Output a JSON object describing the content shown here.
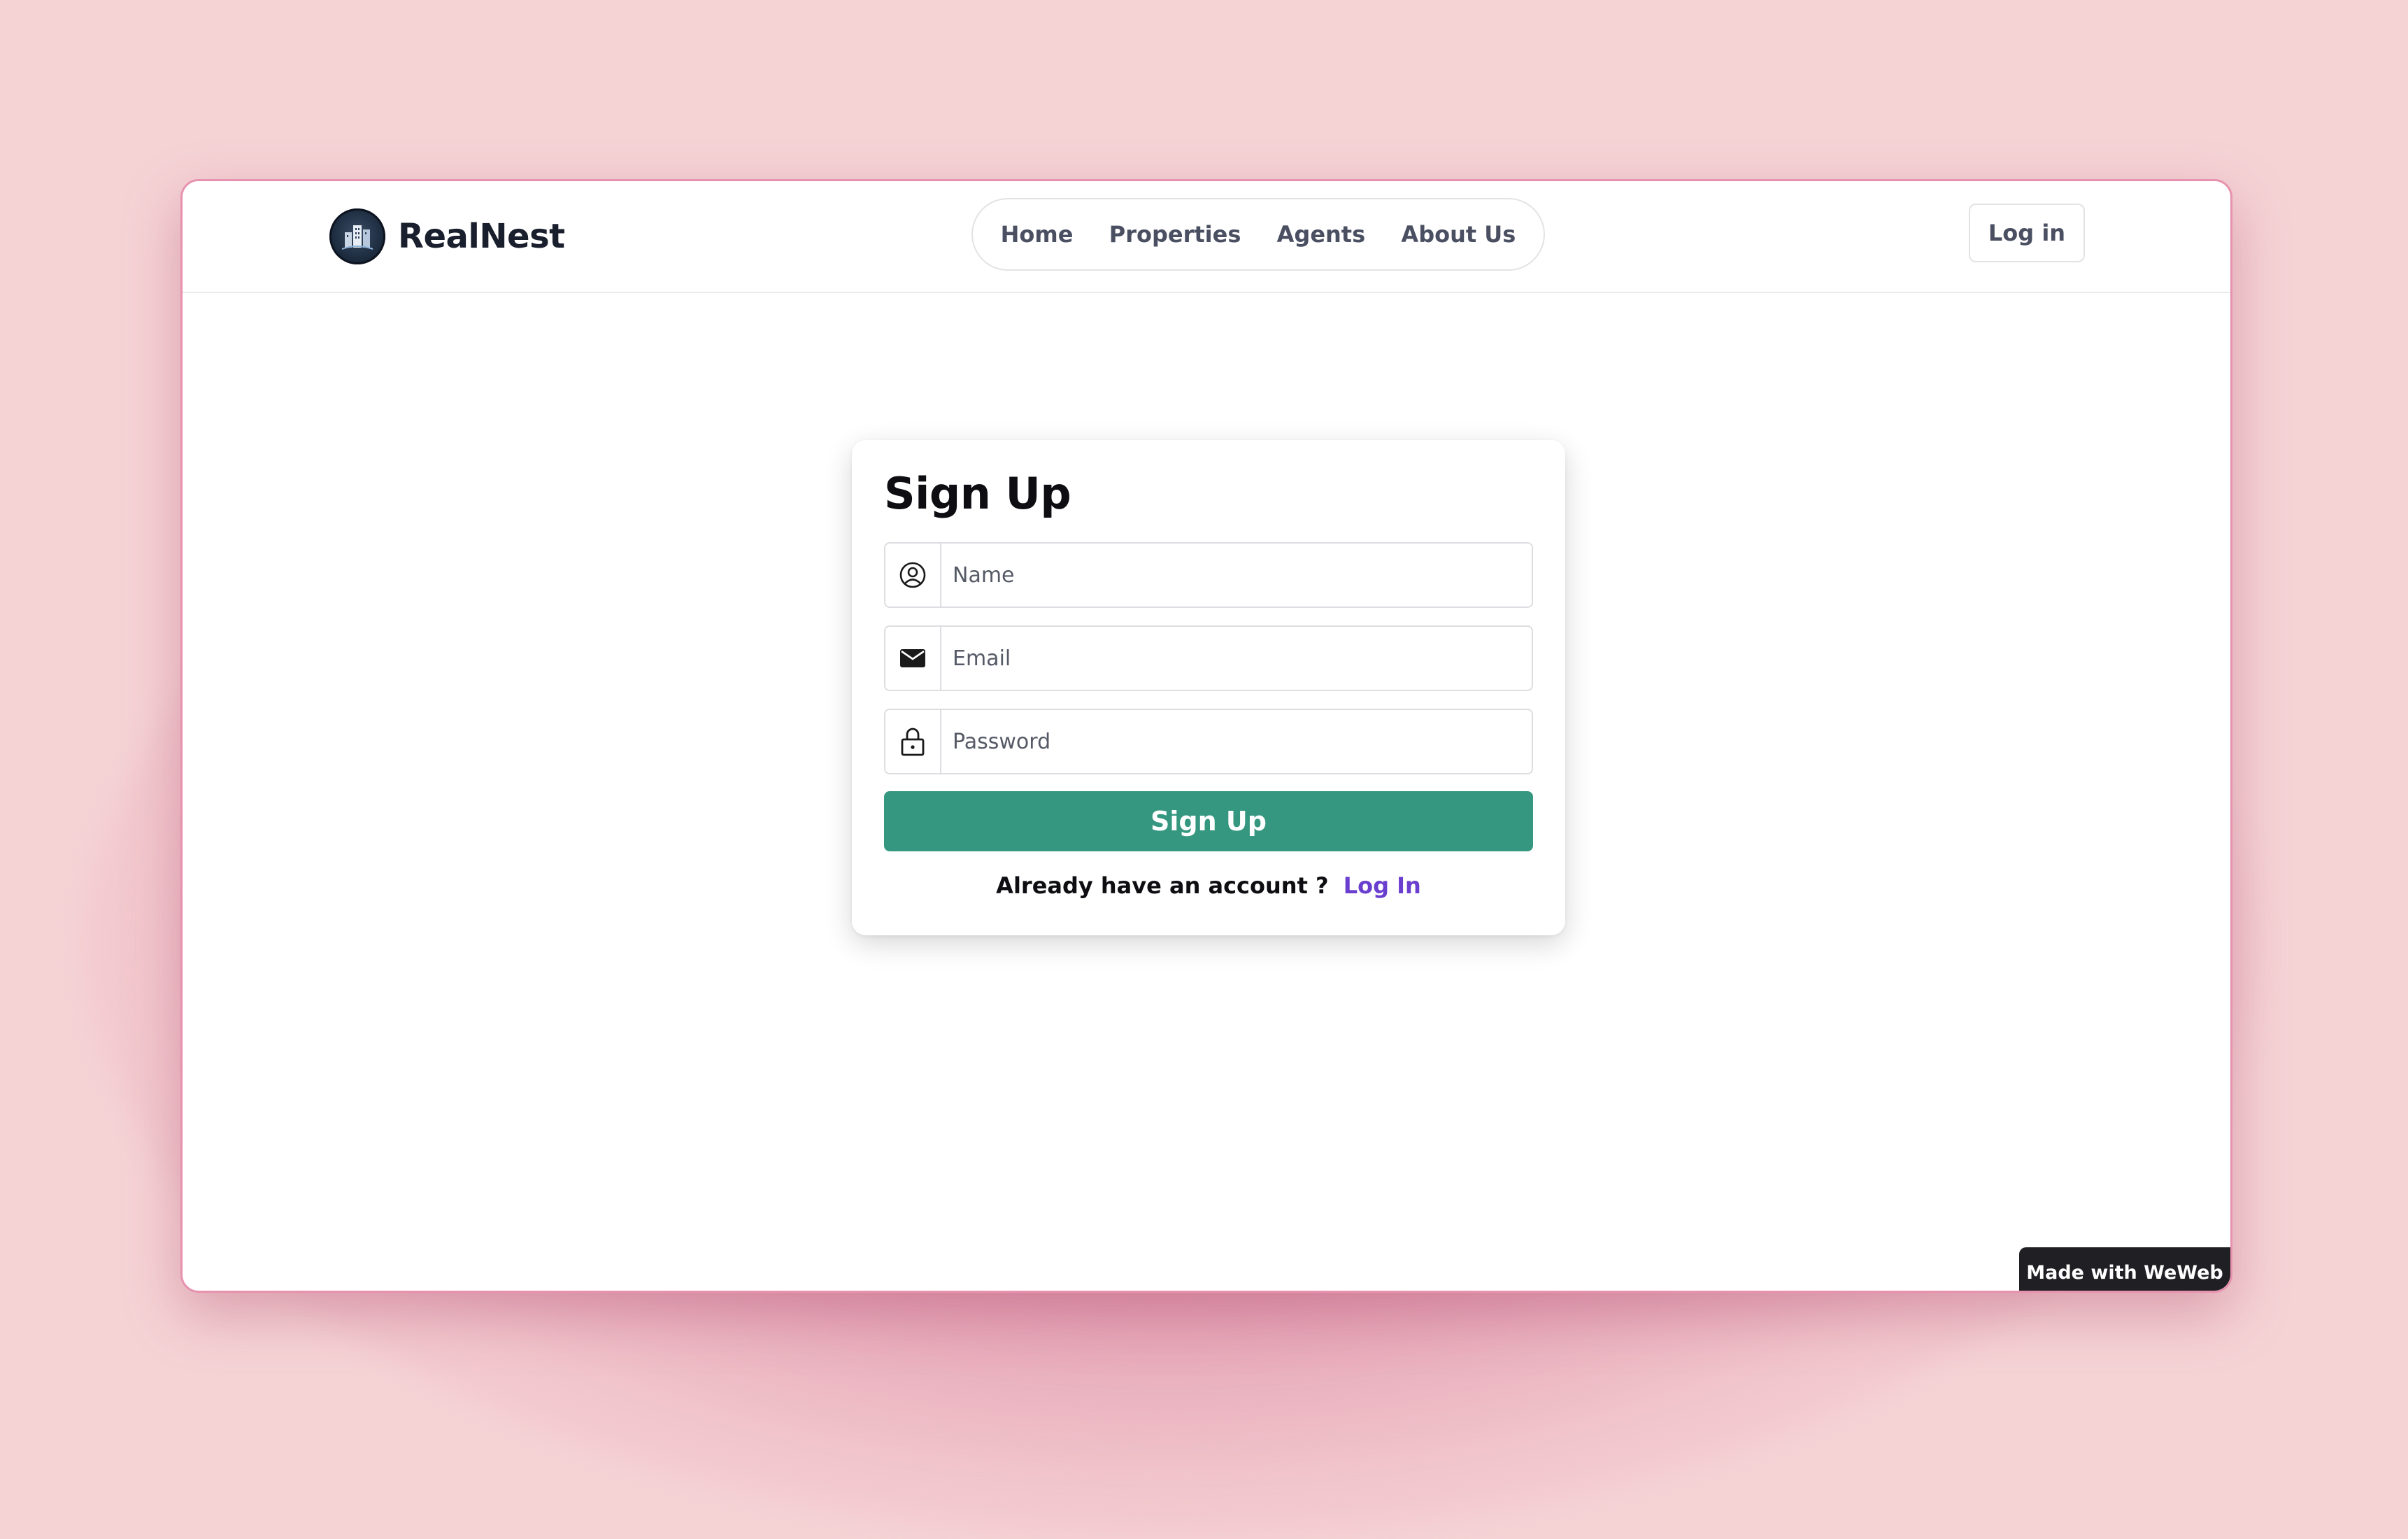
{
  "brand": {
    "name": "RealNest",
    "logo_icon": "building-logo-icon"
  },
  "nav": {
    "items": [
      {
        "label": "Home"
      },
      {
        "label": "Properties"
      },
      {
        "label": "Agents"
      },
      {
        "label": "About Us"
      }
    ],
    "login_label": "Log in"
  },
  "signup": {
    "title": "Sign Up",
    "name_placeholder": "Name",
    "email_placeholder": "Email",
    "password_placeholder": "Password",
    "submit_label": "Sign Up",
    "already_text": "Already have an account ?",
    "login_link": "Log In"
  },
  "badge": {
    "label": "Made with WeWeb"
  },
  "colors": {
    "primary_green": "#35977f",
    "link_purple": "#6a3fcf",
    "window_border": "#e792ae",
    "background_pink": "#f5d3d5"
  }
}
